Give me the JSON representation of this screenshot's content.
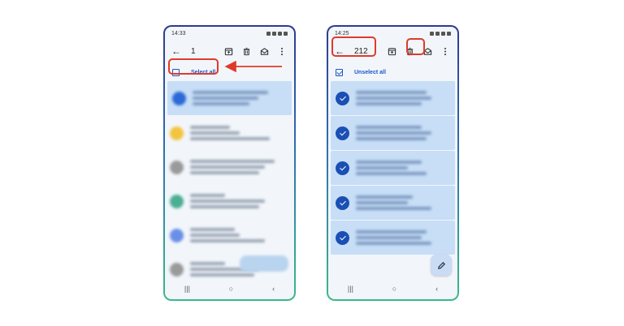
{
  "left_phone": {
    "status_time": "14:33",
    "count": "1",
    "select_label": "Select all",
    "avatar_colors": [
      "#2d69d6",
      "#f3c43f",
      "#9a9a9a",
      "#4cae92",
      "#6a8fe8",
      "#9a9a9a"
    ]
  },
  "right_phone": {
    "status_time": "14:25",
    "count": "212",
    "select_label": "Unselect all",
    "selected_rows": 5
  },
  "nav": {
    "recents": "|||",
    "home": "○",
    "back": "‹"
  },
  "colors": {
    "accent": "#1a56c8",
    "highlight": "#e03a2a",
    "selected_row": "#c7def6"
  }
}
